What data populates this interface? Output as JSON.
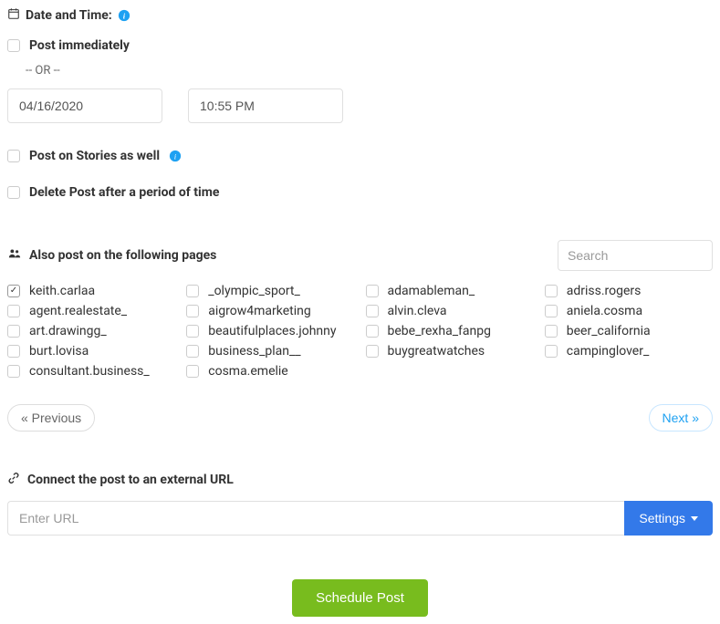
{
  "datetime": {
    "label": "Date and Time:",
    "post_immediately": "Post immediately",
    "or": "-- OR --",
    "date_value": "04/16/2020",
    "time_value": "10:55 PM",
    "post_stories": "Post on Stories as well",
    "delete_post": "Delete Post after a period of time"
  },
  "pages": {
    "label": "Also post on the following pages",
    "search_placeholder": "Search",
    "items": [
      {
        "label": "keith.carlaa",
        "checked": true
      },
      {
        "label": "_olympic_sport_",
        "checked": false
      },
      {
        "label": "adamableman_",
        "checked": false
      },
      {
        "label": "adriss.rogers",
        "checked": false
      },
      {
        "label": "agent.realestate_",
        "checked": false
      },
      {
        "label": "aigrow4marketing",
        "checked": false
      },
      {
        "label": "alvin.cleva",
        "checked": false
      },
      {
        "label": "aniela.cosma",
        "checked": false
      },
      {
        "label": "art.drawingg_",
        "checked": false
      },
      {
        "label": "beautifulplaces.johnny",
        "checked": false
      },
      {
        "label": "bebe_rexha_fanpg",
        "checked": false
      },
      {
        "label": "beer_california",
        "checked": false
      },
      {
        "label": "burt.lovisa",
        "checked": false
      },
      {
        "label": "business_plan__",
        "checked": false
      },
      {
        "label": "buygreatwatches",
        "checked": false
      },
      {
        "label": "campinglover_",
        "checked": false
      },
      {
        "label": "consultant.business_",
        "checked": false
      },
      {
        "label": "cosma.emelie",
        "checked": false
      }
    ],
    "prev": "« Previous",
    "next": "Next »"
  },
  "url": {
    "label": "Connect the post to an external URL",
    "placeholder": "Enter URL",
    "settings": "Settings"
  },
  "submit": {
    "label": "Schedule Post"
  }
}
